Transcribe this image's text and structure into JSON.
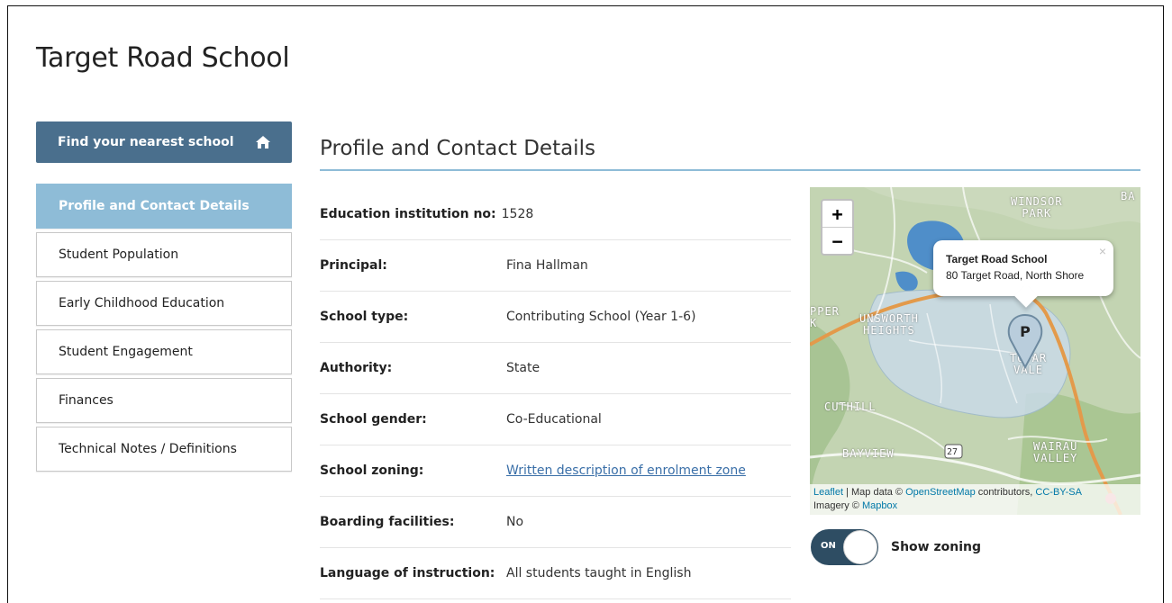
{
  "page": {
    "title": "Target Road School"
  },
  "find_button": {
    "label": "Find your nearest school",
    "icon": "home-icon"
  },
  "sidebar": {
    "items": [
      {
        "label": "Profile and Contact Details",
        "active": true
      },
      {
        "label": "Student Population"
      },
      {
        "label": "Early Childhood Education"
      },
      {
        "label": "Student Engagement"
      },
      {
        "label": "Finances"
      },
      {
        "label": "Technical Notes / Definitions"
      }
    ]
  },
  "section": {
    "title": "Profile and Contact Details"
  },
  "details": {
    "institution_no": {
      "label": "Education institution no:",
      "value": "1528"
    },
    "principal": {
      "label": "Principal:",
      "value": "Fina Hallman"
    },
    "school_type": {
      "label": "School type:",
      "value": "Contributing School (Year 1-6)"
    },
    "authority": {
      "label": "Authority:",
      "value": "State"
    },
    "gender": {
      "label": "School gender:",
      "value": "Co-Educational"
    },
    "zoning": {
      "label": "School zoning:",
      "value": "Written description of enrolment zone"
    },
    "boarding": {
      "label": "Boarding facilities:",
      "value": "No"
    },
    "language": {
      "label": "Language of instruction:",
      "value": "All students taught in English"
    }
  },
  "map": {
    "zoom_in": "+",
    "zoom_out": "−",
    "popup": {
      "title": "Target Road School",
      "address": "80 Target Road, North Shore",
      "close": "×"
    },
    "marker_letter": "P",
    "labels": {
      "windsor": "WINDSOR\nPARK",
      "unsworth": "UNSWORTH\nHEIGHTS",
      "totara": "TŌTAR\nVALE",
      "cuthill": "CUTHILL",
      "bayview": "BAYVIEW",
      "wairau": "WAIRAU\nVALLEY",
      "road_number": "27",
      "edge_per": "PPER\nK",
      "edge_ba": "BA"
    },
    "attribution": {
      "leaflet": "Leaflet",
      "map_data": " | Map data © ",
      "osm": "OpenStreetMap",
      "contrib": " contributors, ",
      "license": "CC-BY-SA",
      "imagery": "Imagery © ",
      "mapbox": "Mapbox"
    },
    "colors": {
      "zone_fill": "#c9dbe8",
      "road": "#e39a4b",
      "water": "#4f8ec9",
      "land": "#b7cfa3"
    }
  },
  "zoning_toggle": {
    "state": "ON",
    "label": "Show zoning"
  },
  "colors": {
    "primary": "#4a6f8d",
    "active_nav": "#8ebcd7",
    "link": "#3a6fa8",
    "toggle": "#2e4d63"
  }
}
